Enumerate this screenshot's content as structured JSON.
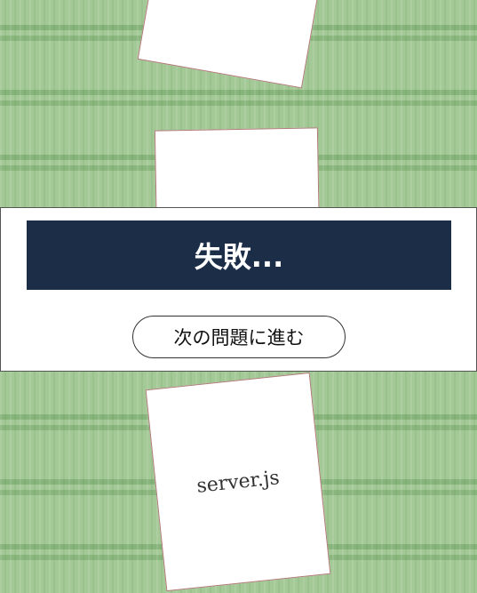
{
  "result": {
    "title": "失敗..."
  },
  "next_button": {
    "label": "次の問題に進む"
  },
  "cards": [
    {
      "label": ""
    },
    {
      "label": ""
    },
    {
      "label": "server.js"
    }
  ],
  "colors": {
    "banner": "#1c2d48",
    "mat": "#a6cc98",
    "card_border": "#b07a78"
  }
}
